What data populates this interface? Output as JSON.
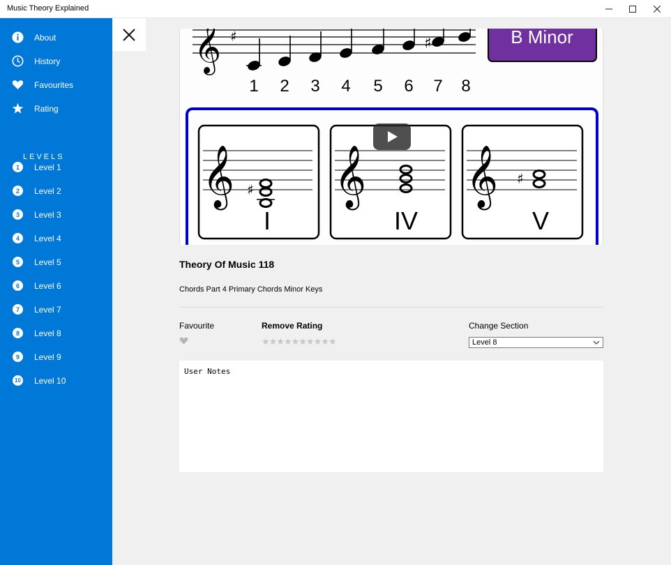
{
  "window": {
    "title": "Music Theory Explained",
    "buttons": [
      "minimize",
      "maximize",
      "close"
    ]
  },
  "sidebar": {
    "accent": "#0078d7",
    "menu": [
      {
        "label": "About",
        "icon": "info-icon"
      },
      {
        "label": "History",
        "icon": "clock-icon"
      },
      {
        "label": "Favourites",
        "icon": "heart-icon"
      },
      {
        "label": "Rating",
        "icon": "star-icon"
      }
    ],
    "levels_heading": "LEVELS",
    "levels": [
      {
        "num": "1",
        "label": "Level 1"
      },
      {
        "num": "2",
        "label": "Level 2"
      },
      {
        "num": "3",
        "label": "Level 3"
      },
      {
        "num": "4",
        "label": "Level 4"
      },
      {
        "num": "5",
        "label": "Level 5"
      },
      {
        "num": "6",
        "label": "Level 6"
      },
      {
        "num": "7",
        "label": "Level 7"
      },
      {
        "num": "8",
        "label": "Level 8"
      },
      {
        "num": "9",
        "label": "Level 9"
      },
      {
        "num": "10",
        "label": "Level 10"
      }
    ]
  },
  "video": {
    "key_label": "B Minor",
    "scale_numbers": [
      "1",
      "2",
      "3",
      "4",
      "5",
      "6",
      "7",
      "8"
    ],
    "chord_labels": [
      "I",
      "IV",
      "V"
    ],
    "key_box_color": "#7030a0",
    "border_color": "#0000cc"
  },
  "detail": {
    "title": "Theory Of Music 118",
    "description": "Chords Part 4 Primary Chords Minor Keys",
    "favourite_label": "Favourite",
    "rating_label": "Remove Rating",
    "stars": "★★★★★★★★★★",
    "section_label": "Change Section",
    "section_value": "Level 8",
    "notes_placeholder": "User Notes"
  }
}
